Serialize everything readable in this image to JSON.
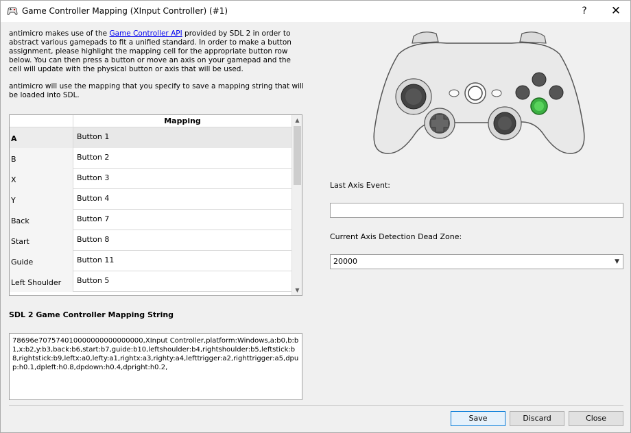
{
  "window": {
    "title": "Game Controller Mapping (XInput Controller) (#1)",
    "help_glyph": "?",
    "close_glyph": "✕"
  },
  "intro": {
    "p1_before": "antimicro makes use of the ",
    "p1_link": "Game Controller API",
    "p1_after": " provided by SDL 2 in order to abstract various gamepads to fit a unified standard. In order to make a button assignment, please highlight the mapping cell for the appropriate button row below. You can then press a button or move an axis on your gamepad and the cell will update with the physical button or axis that will be used.",
    "p2": "antimicro will use the mapping that you specify to save a mapping string that will be loaded into SDL."
  },
  "mapping_table": {
    "header": "Mapping",
    "rows": [
      {
        "name": "A",
        "value": "Button 1"
      },
      {
        "name": "B",
        "value": "Button 2"
      },
      {
        "name": "X",
        "value": "Button 3"
      },
      {
        "name": "Y",
        "value": "Button 4"
      },
      {
        "name": "Back",
        "value": "Button 7"
      },
      {
        "name": "Start",
        "value": "Button 8"
      },
      {
        "name": "Guide",
        "value": "Button 11"
      },
      {
        "name": "Left Shoulder",
        "value": "Button 5"
      }
    ],
    "scroll_up": "▲",
    "scroll_down": "▼"
  },
  "mapping_string": {
    "label": "SDL 2 Game Controller Mapping String",
    "value": "78696e707574010000000000000000,XInput Controller,platform:Windows,a:b0,b:b1,x:b2,y:b3,back:b6,start:b7,guide:b10,leftshoulder:b4,rightshoulder:b5,leftstick:b8,rightstick:b9,leftx:a0,lefty:a1,rightx:a3,righty:a4,lefttrigger:a2,righttrigger:a5,dpup:h0.1,dpleft:h0.8,dpdown:h0.4,dpright:h0.2,"
  },
  "axis": {
    "last_event_label": "Last Axis Event:",
    "last_event_value": "",
    "dead_zone_label": "Current Axis Detection Dead Zone:",
    "dead_zone_value": "20000",
    "caret": "▼"
  },
  "buttons": {
    "save": "Save",
    "discard": "Discard",
    "close": "Close"
  },
  "colors": {
    "accent": "#0078d7",
    "link": "#0000ee",
    "highlight_button": "#3cb043"
  }
}
